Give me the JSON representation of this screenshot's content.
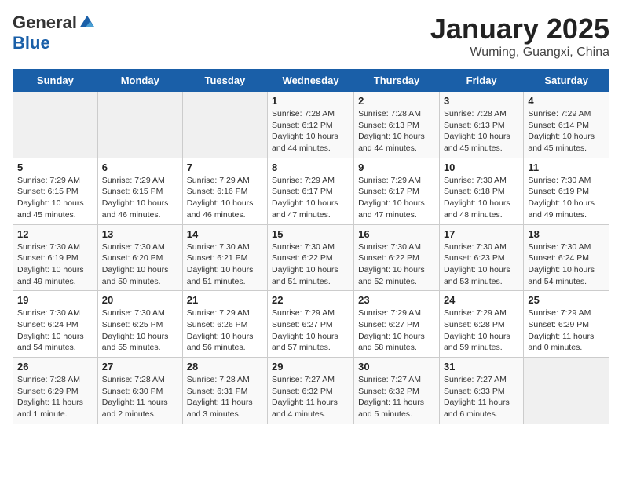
{
  "header": {
    "logo_general": "General",
    "logo_blue": "Blue",
    "month": "January 2025",
    "location": "Wuming, Guangxi, China"
  },
  "weekdays": [
    "Sunday",
    "Monday",
    "Tuesday",
    "Wednesday",
    "Thursday",
    "Friday",
    "Saturday"
  ],
  "weeks": [
    [
      {
        "day": "",
        "info": ""
      },
      {
        "day": "",
        "info": ""
      },
      {
        "day": "",
        "info": ""
      },
      {
        "day": "1",
        "info": "Sunrise: 7:28 AM\nSunset: 6:12 PM\nDaylight: 10 hours\nand 44 minutes."
      },
      {
        "day": "2",
        "info": "Sunrise: 7:28 AM\nSunset: 6:13 PM\nDaylight: 10 hours\nand 44 minutes."
      },
      {
        "day": "3",
        "info": "Sunrise: 7:28 AM\nSunset: 6:13 PM\nDaylight: 10 hours\nand 45 minutes."
      },
      {
        "day": "4",
        "info": "Sunrise: 7:29 AM\nSunset: 6:14 PM\nDaylight: 10 hours\nand 45 minutes."
      }
    ],
    [
      {
        "day": "5",
        "info": "Sunrise: 7:29 AM\nSunset: 6:15 PM\nDaylight: 10 hours\nand 45 minutes."
      },
      {
        "day": "6",
        "info": "Sunrise: 7:29 AM\nSunset: 6:15 PM\nDaylight: 10 hours\nand 46 minutes."
      },
      {
        "day": "7",
        "info": "Sunrise: 7:29 AM\nSunset: 6:16 PM\nDaylight: 10 hours\nand 46 minutes."
      },
      {
        "day": "8",
        "info": "Sunrise: 7:29 AM\nSunset: 6:17 PM\nDaylight: 10 hours\nand 47 minutes."
      },
      {
        "day": "9",
        "info": "Sunrise: 7:29 AM\nSunset: 6:17 PM\nDaylight: 10 hours\nand 47 minutes."
      },
      {
        "day": "10",
        "info": "Sunrise: 7:30 AM\nSunset: 6:18 PM\nDaylight: 10 hours\nand 48 minutes."
      },
      {
        "day": "11",
        "info": "Sunrise: 7:30 AM\nSunset: 6:19 PM\nDaylight: 10 hours\nand 49 minutes."
      }
    ],
    [
      {
        "day": "12",
        "info": "Sunrise: 7:30 AM\nSunset: 6:19 PM\nDaylight: 10 hours\nand 49 minutes."
      },
      {
        "day": "13",
        "info": "Sunrise: 7:30 AM\nSunset: 6:20 PM\nDaylight: 10 hours\nand 50 minutes."
      },
      {
        "day": "14",
        "info": "Sunrise: 7:30 AM\nSunset: 6:21 PM\nDaylight: 10 hours\nand 51 minutes."
      },
      {
        "day": "15",
        "info": "Sunrise: 7:30 AM\nSunset: 6:22 PM\nDaylight: 10 hours\nand 51 minutes."
      },
      {
        "day": "16",
        "info": "Sunrise: 7:30 AM\nSunset: 6:22 PM\nDaylight: 10 hours\nand 52 minutes."
      },
      {
        "day": "17",
        "info": "Sunrise: 7:30 AM\nSunset: 6:23 PM\nDaylight: 10 hours\nand 53 minutes."
      },
      {
        "day": "18",
        "info": "Sunrise: 7:30 AM\nSunset: 6:24 PM\nDaylight: 10 hours\nand 54 minutes."
      }
    ],
    [
      {
        "day": "19",
        "info": "Sunrise: 7:30 AM\nSunset: 6:24 PM\nDaylight: 10 hours\nand 54 minutes."
      },
      {
        "day": "20",
        "info": "Sunrise: 7:30 AM\nSunset: 6:25 PM\nDaylight: 10 hours\nand 55 minutes."
      },
      {
        "day": "21",
        "info": "Sunrise: 7:29 AM\nSunset: 6:26 PM\nDaylight: 10 hours\nand 56 minutes."
      },
      {
        "day": "22",
        "info": "Sunrise: 7:29 AM\nSunset: 6:27 PM\nDaylight: 10 hours\nand 57 minutes."
      },
      {
        "day": "23",
        "info": "Sunrise: 7:29 AM\nSunset: 6:27 PM\nDaylight: 10 hours\nand 58 minutes."
      },
      {
        "day": "24",
        "info": "Sunrise: 7:29 AM\nSunset: 6:28 PM\nDaylight: 10 hours\nand 59 minutes."
      },
      {
        "day": "25",
        "info": "Sunrise: 7:29 AM\nSunset: 6:29 PM\nDaylight: 11 hours\nand 0 minutes."
      }
    ],
    [
      {
        "day": "26",
        "info": "Sunrise: 7:28 AM\nSunset: 6:29 PM\nDaylight: 11 hours\nand 1 minute."
      },
      {
        "day": "27",
        "info": "Sunrise: 7:28 AM\nSunset: 6:30 PM\nDaylight: 11 hours\nand 2 minutes."
      },
      {
        "day": "28",
        "info": "Sunrise: 7:28 AM\nSunset: 6:31 PM\nDaylight: 11 hours\nand 3 minutes."
      },
      {
        "day": "29",
        "info": "Sunrise: 7:27 AM\nSunset: 6:32 PM\nDaylight: 11 hours\nand 4 minutes."
      },
      {
        "day": "30",
        "info": "Sunrise: 7:27 AM\nSunset: 6:32 PM\nDaylight: 11 hours\nand 5 minutes."
      },
      {
        "day": "31",
        "info": "Sunrise: 7:27 AM\nSunset: 6:33 PM\nDaylight: 11 hours\nand 6 minutes."
      },
      {
        "day": "",
        "info": ""
      }
    ]
  ]
}
